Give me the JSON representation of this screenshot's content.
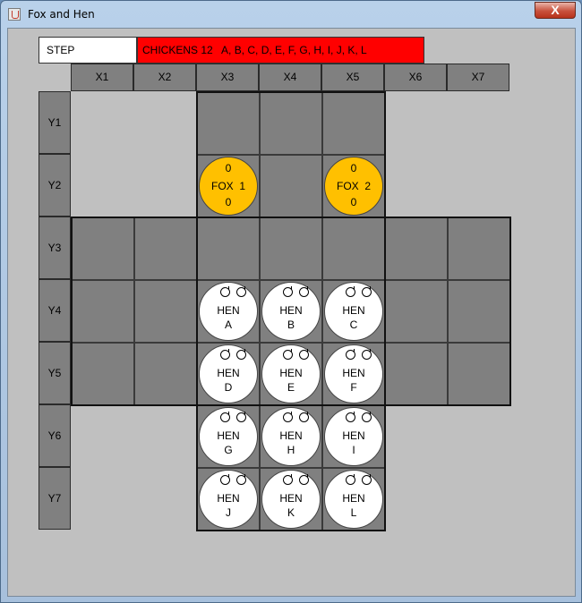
{
  "window": {
    "title": "Fox and Hen",
    "close_label": "X"
  },
  "status": {
    "step_label": "STEP",
    "chickens_text": "CHICKENS 12   A, B, C, D, E, F, G, H, I, J, K, L"
  },
  "columns": [
    "X1",
    "X2",
    "X3",
    "X4",
    "X5",
    "X6",
    "X7"
  ],
  "rows": [
    "Y1",
    "Y2",
    "Y3",
    "Y4",
    "Y5",
    "Y6",
    "Y7"
  ],
  "colors": {
    "board": "#808080",
    "fox": "#ffc000",
    "hen": "#ffffff",
    "status": "#ff0000",
    "background": "#c0c0c0"
  },
  "cells": [
    [
      3,
      1
    ],
    [
      4,
      1
    ],
    [
      5,
      1
    ],
    [
      3,
      2
    ],
    [
      4,
      2
    ],
    [
      5,
      2
    ],
    [
      1,
      3
    ],
    [
      2,
      3
    ],
    [
      3,
      3
    ],
    [
      4,
      3
    ],
    [
      5,
      3
    ],
    [
      6,
      3
    ],
    [
      7,
      3
    ],
    [
      1,
      4
    ],
    [
      2,
      4
    ],
    [
      3,
      4
    ],
    [
      4,
      4
    ],
    [
      5,
      4
    ],
    [
      6,
      4
    ],
    [
      7,
      4
    ],
    [
      1,
      5
    ],
    [
      2,
      5
    ],
    [
      3,
      5
    ],
    [
      4,
      5
    ],
    [
      5,
      5
    ],
    [
      6,
      5
    ],
    [
      7,
      5
    ],
    [
      3,
      6
    ],
    [
      4,
      6
    ],
    [
      5,
      6
    ],
    [
      3,
      7
    ],
    [
      4,
      7
    ],
    [
      5,
      7
    ]
  ],
  "foxes": [
    {
      "id": "1",
      "col": 3,
      "row": 2,
      "top": "0",
      "label": "FOX  1",
      "bottom": "0"
    },
    {
      "id": "2",
      "col": 5,
      "row": 2,
      "top": "0",
      "label": "FOX  2",
      "bottom": "0"
    }
  ],
  "hens": [
    {
      "col": 3,
      "row": 4,
      "label": "HEN",
      "letter": "A"
    },
    {
      "col": 4,
      "row": 4,
      "label": "HEN",
      "letter": "B"
    },
    {
      "col": 5,
      "row": 4,
      "label": "HEN",
      "letter": "C"
    },
    {
      "col": 3,
      "row": 5,
      "label": "HEN",
      "letter": "D"
    },
    {
      "col": 4,
      "row": 5,
      "label": "HEN",
      "letter": "E"
    },
    {
      "col": 5,
      "row": 5,
      "label": "HEN",
      "letter": "F"
    },
    {
      "col": 3,
      "row": 6,
      "label": "HEN",
      "letter": "G"
    },
    {
      "col": 4,
      "row": 6,
      "label": "HEN",
      "letter": "H"
    },
    {
      "col": 5,
      "row": 6,
      "label": "HEN",
      "letter": "I"
    },
    {
      "col": 3,
      "row": 7,
      "label": "HEN",
      "letter": "J"
    },
    {
      "col": 4,
      "row": 7,
      "label": "HEN",
      "letter": "K"
    },
    {
      "col": 5,
      "row": 7,
      "label": "HEN",
      "letter": "L"
    }
  ]
}
